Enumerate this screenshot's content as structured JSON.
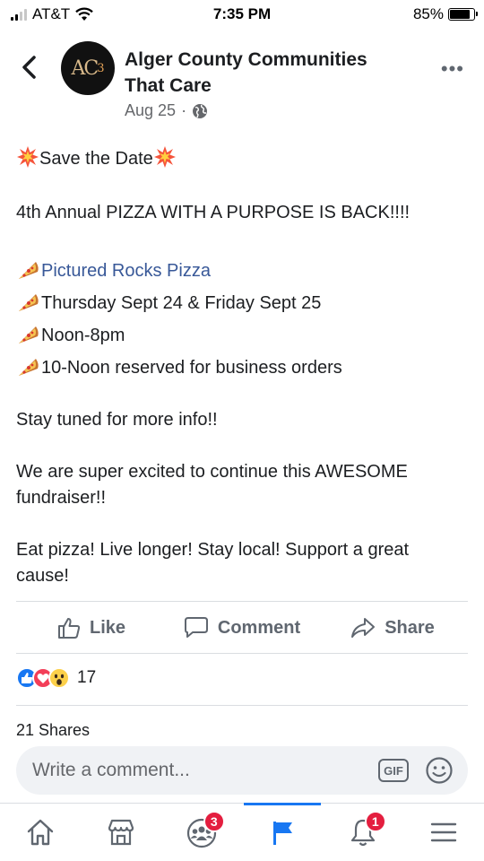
{
  "status_bar": {
    "carrier": "AT&T",
    "time": "7:35 PM",
    "battery": "85%",
    "battery_level": 0.85
  },
  "post": {
    "page_name": "Alger County Communities That Care",
    "avatar_text": "AC",
    "avatar_sub": "3",
    "date": "Aug 25",
    "meta_separator": "·",
    "privacy_icon": "globe-icon",
    "lines": {
      "save_the_date": "Save the Date",
      "headline": "4th Annual PIZZA WITH A PURPOSE IS BACK!!!!",
      "location": "Pictured Rocks Pizza",
      "dates": "Thursday Sept 24 & Friday Sept 25",
      "hours": "Noon-8pm",
      "business": "10-Noon reserved for business orders",
      "stay_tuned": "Stay tuned for more info!!",
      "excited": "We are super excited to continue this AWESOME fundraiser!!",
      "closing": "Eat pizza! Live longer! Stay local! Support a great cause!"
    }
  },
  "actions": {
    "like": "Like",
    "comment": "Comment",
    "share": "Share"
  },
  "reactions": {
    "types": [
      "like",
      "love",
      "wow"
    ],
    "count": "17"
  },
  "shares_text": "21 Shares",
  "composer": {
    "placeholder": "Write a comment...",
    "gif_label": "GIF"
  },
  "tabbar": {
    "tabs": [
      {
        "name": "home",
        "badge": ""
      },
      {
        "name": "marketplace",
        "badge": ""
      },
      {
        "name": "groups",
        "badge": "3"
      },
      {
        "name": "pages",
        "badge": "",
        "active": true
      },
      {
        "name": "notifications",
        "badge": "1"
      },
      {
        "name": "menu",
        "badge": ""
      }
    ]
  },
  "colors": {
    "accent": "#1877f2",
    "link": "#385898",
    "badge": "#e41e3f",
    "secondary_text": "#65676b"
  }
}
